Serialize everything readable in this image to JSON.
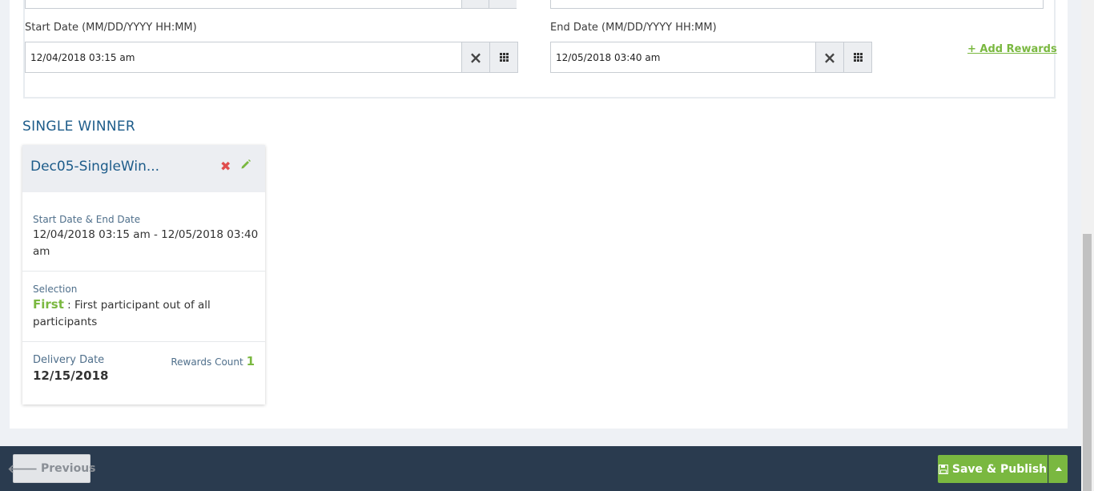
{
  "form": {
    "start_date_label": "Start Date (MM/DD/YYYY HH:MM)",
    "start_date_value": "12/04/2018 03:15 am",
    "end_date_label": "End Date (MM/DD/YYYY HH:MM)",
    "end_date_value": "12/05/2018 03:40 am",
    "add_rewards_label": "+ Add Rewards",
    "clear_icon": "×"
  },
  "section": {
    "title": "SINGLE WINNER"
  },
  "card": {
    "name": "Dec05-SingleWin...",
    "delete_icon": "✖",
    "dates_label": "Start Date & End Date",
    "dates_value": "12/04/2018 03:15 am - 12/05/2018 03:40 am",
    "selection_label": "Selection",
    "selection_type": "First",
    "selection_desc": " : First participant out of all participants",
    "delivery_label": "Delivery Date",
    "delivery_value": "12/15/2018",
    "rewards_count_label": "Rewards Count",
    "rewards_count_value": "1"
  },
  "footer": {
    "previous_label": "Previous",
    "save_label": "Save & Publish"
  },
  "colors": {
    "accent_green": "#7ab840",
    "title_blue": "#1d5c8a",
    "footer_bg": "#2a3b4f",
    "delete_red": "#e04e4e"
  }
}
